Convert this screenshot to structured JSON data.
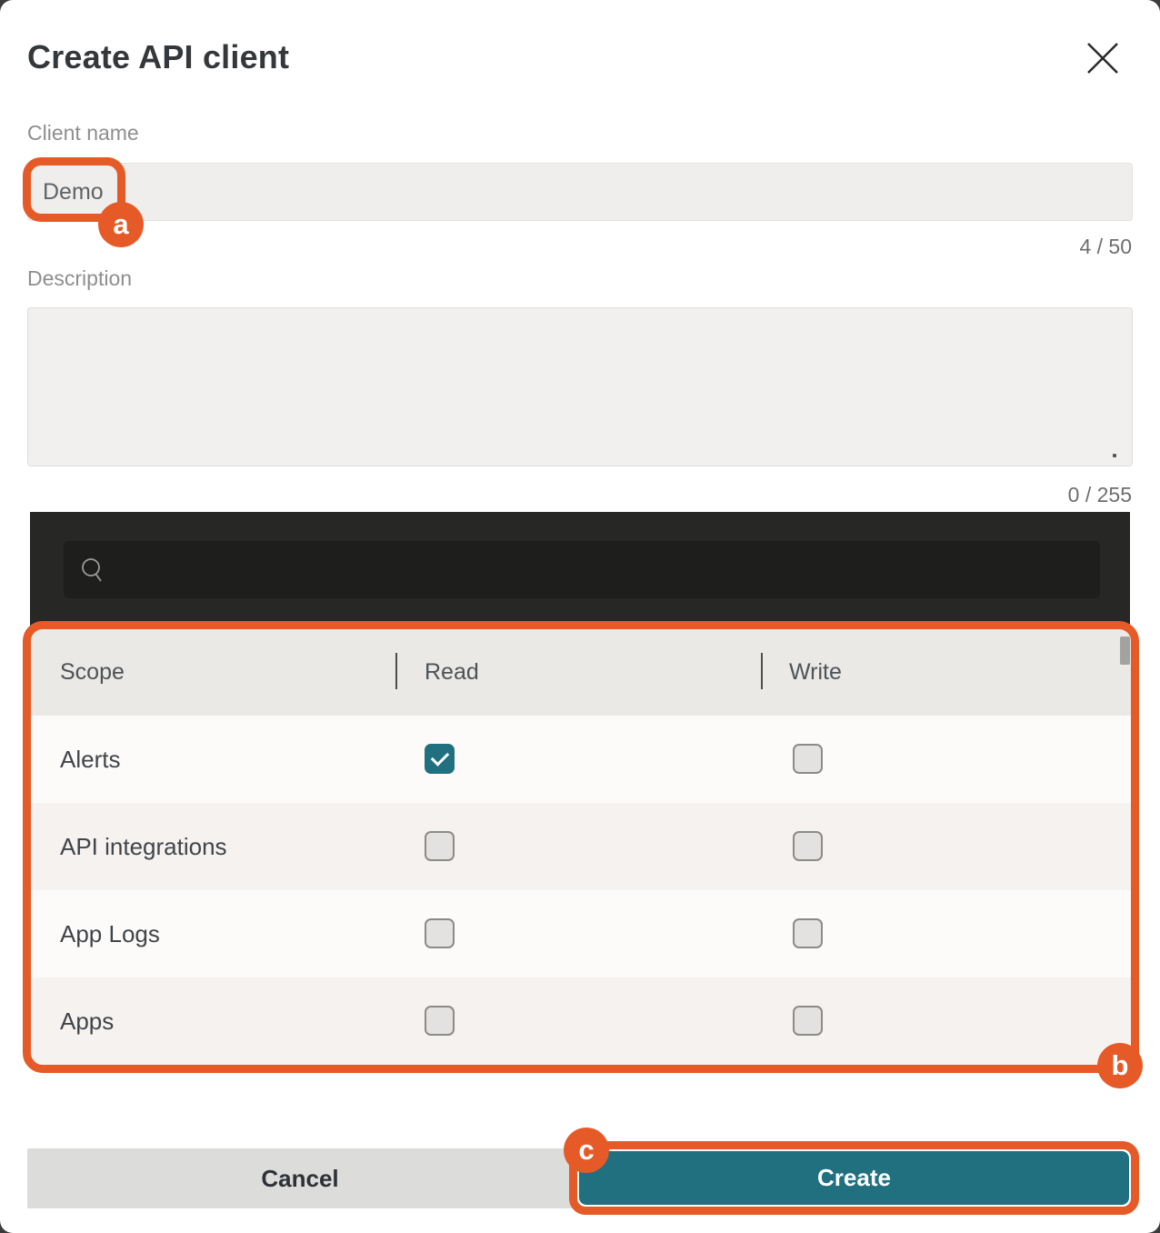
{
  "modal": {
    "title": "Create API client",
    "close_icon": "x-icon"
  },
  "fields": {
    "client_name": {
      "label": "Client name",
      "value": "Demo",
      "counter": "4 / 50"
    },
    "description": {
      "label": "Description",
      "value": "",
      "counter": "0 / 255"
    }
  },
  "search": {
    "placeholder": "",
    "icon": "magnifier-icon"
  },
  "scopes_table": {
    "columns": [
      "Scope",
      "Read",
      "Write"
    ],
    "rows": [
      {
        "name": "Alerts",
        "read": true,
        "write": false
      },
      {
        "name": "API integrations",
        "read": false,
        "write": false
      },
      {
        "name": "App Logs",
        "read": false,
        "write": false
      },
      {
        "name": "Apps",
        "read": false,
        "write": false
      }
    ]
  },
  "footer": {
    "cancel_label": "Cancel",
    "create_label": "Create"
  },
  "annotations": {
    "a": "a",
    "b": "b",
    "c": "c"
  },
  "colors": {
    "annotation_orange": "#e65a28",
    "teal_accent": "#20707f",
    "dark_panel": "#272725",
    "header_gray": "#eae9e6"
  }
}
